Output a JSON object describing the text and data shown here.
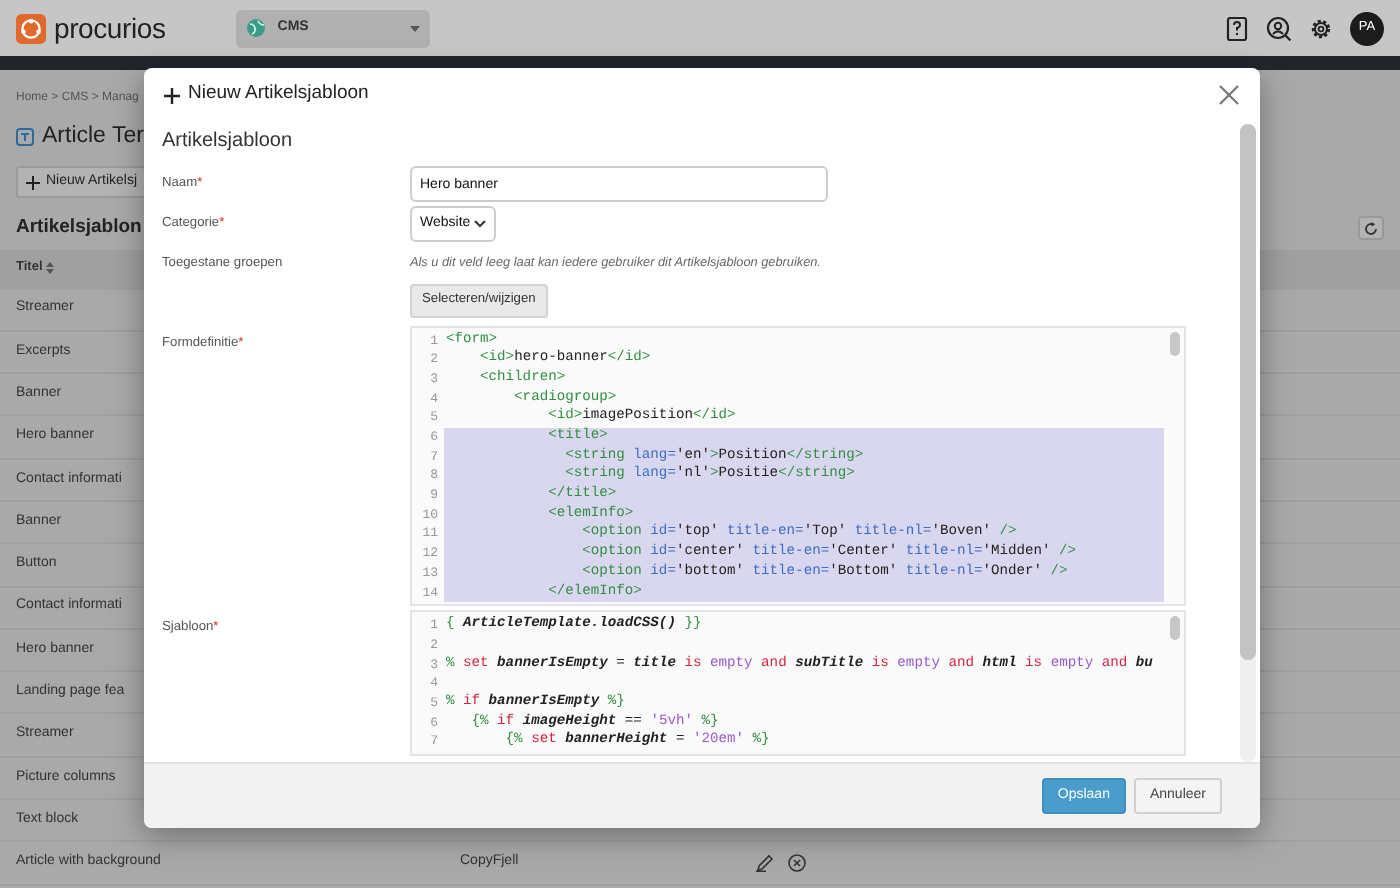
{
  "header": {
    "logo": "procurios",
    "app_switcher": "CMS",
    "avatar": "PA"
  },
  "breadcrumb": "Home > CMS > Manag",
  "page_title": "Article Ter",
  "new_button": "Nieuw Artikelsj",
  "section_title": "Artikelsjablon",
  "table": {
    "columns": [
      "Titel"
    ],
    "rows": [
      {
        "title": "Streamer"
      },
      {
        "title": "Excerpts"
      },
      {
        "title": "Banner"
      },
      {
        "title": "Hero banner"
      },
      {
        "title": "Contact informati"
      },
      {
        "title": "Banner"
      },
      {
        "title": "Button"
      },
      {
        "title": "Contact informati"
      },
      {
        "title": "Hero banner"
      },
      {
        "title": "Landing page fea"
      },
      {
        "title": "Streamer"
      },
      {
        "title": "Picture columns"
      },
      {
        "title": "Text block"
      },
      {
        "title": "Article with background",
        "column_2": "CopyFjell"
      }
    ]
  },
  "modal": {
    "title": "Nieuw Artikelsjabloon",
    "heading": "Artikelsjabloon",
    "fields": [
      {
        "kind": "text",
        "label": "Naam",
        "required_mark": "*",
        "value": "Hero banner"
      },
      {
        "kind": "select",
        "label": "Categorie",
        "required_mark": "*",
        "value": "Website"
      },
      {
        "kind": "groups",
        "label": "Toegestane groepen",
        "help": "Als u dit veld leeg laat kan iedere gebruiker dit Artikelsjabloon gebruiken.",
        "button": "Selecteren/wijzigen"
      },
      {
        "kind": "code",
        "label": "Formdefinitie",
        "required_mark": "*",
        "lines": [
          {
            "number": "1",
            "selected": false,
            "tokens": [
              {
                "kind": "tag",
                "text": "<form>"
              }
            ]
          },
          {
            "number": "2",
            "selected": false,
            "tokens": [
              {
                "kind": "tag",
                "text": "    <id>"
              },
              {
                "kind": "text",
                "text": "hero-banner"
              },
              {
                "kind": "tag",
                "text": "</id>"
              }
            ]
          },
          {
            "number": "3",
            "selected": false,
            "tokens": [
              {
                "kind": "tag",
                "text": "    <children>"
              }
            ]
          },
          {
            "number": "4",
            "selected": false,
            "tokens": [
              {
                "kind": "tag",
                "text": "        <radiogroup>"
              }
            ]
          },
          {
            "number": "5",
            "selected": false,
            "tokens": [
              {
                "kind": "tag",
                "text": "            <id>"
              },
              {
                "kind": "text",
                "text": "imagePosition"
              },
              {
                "kind": "tag",
                "text": "</id>"
              }
            ]
          },
          {
            "number": "6",
            "selected": true,
            "tokens": [
              {
                "kind": "tag",
                "text": "            <title>"
              }
            ]
          },
          {
            "number": "7",
            "selected": true,
            "tokens": [
              {
                "kind": "tag",
                "text": "              <string"
              },
              {
                "kind": "attr",
                "text": " lang="
              },
              {
                "kind": "text",
                "text": "'en'"
              },
              {
                "kind": "tag",
                "text": ">"
              },
              {
                "kind": "text",
                "text": "Position"
              },
              {
                "kind": "tag",
                "text": "</string>"
              }
            ]
          },
          {
            "number": "8",
            "selected": true,
            "tokens": [
              {
                "kind": "tag",
                "text": "              <string"
              },
              {
                "kind": "attr",
                "text": " lang="
              },
              {
                "kind": "text",
                "text": "'nl'"
              },
              {
                "kind": "tag",
                "text": ">"
              },
              {
                "kind": "text",
                "text": "Positie"
              },
              {
                "kind": "tag",
                "text": "</string>"
              }
            ]
          },
          {
            "number": "9",
            "selected": true,
            "tokens": [
              {
                "kind": "tag",
                "text": "            </title>"
              }
            ]
          },
          {
            "number": "10",
            "selected": true,
            "tokens": [
              {
                "kind": "tag",
                "text": "            <elemInfo>"
              }
            ]
          },
          {
            "number": "11",
            "selected": true,
            "tokens": [
              {
                "kind": "tag",
                "text": "                <option"
              },
              {
                "kind": "attr",
                "text": " id="
              },
              {
                "kind": "text",
                "text": "'top'"
              },
              {
                "kind": "attr",
                "text": " title-en="
              },
              {
                "kind": "text",
                "text": "'Top'"
              },
              {
                "kind": "attr",
                "text": " title-nl="
              },
              {
                "kind": "text",
                "text": "'Boven'"
              },
              {
                "kind": "tag",
                "text": " />"
              }
            ]
          },
          {
            "number": "12",
            "selected": true,
            "tokens": [
              {
                "kind": "tag",
                "text": "                <option"
              },
              {
                "kind": "attr",
                "text": " id="
              },
              {
                "kind": "text",
                "text": "'center'"
              },
              {
                "kind": "attr",
                "text": " title-en="
              },
              {
                "kind": "text",
                "text": "'Center'"
              },
              {
                "kind": "attr",
                "text": " title-nl="
              },
              {
                "kind": "text",
                "text": "'Midden'"
              },
              {
                "kind": "tag",
                "text": " />"
              }
            ]
          },
          {
            "number": "13",
            "selected": true,
            "tokens": [
              {
                "kind": "tag",
                "text": "                <option"
              },
              {
                "kind": "attr",
                "text": " id="
              },
              {
                "kind": "text",
                "text": "'bottom'"
              },
              {
                "kind": "attr",
                "text": " title-en="
              },
              {
                "kind": "text",
                "text": "'Bottom'"
              },
              {
                "kind": "attr",
                "text": " title-nl="
              },
              {
                "kind": "text",
                "text": "'Onder'"
              },
              {
                "kind": "tag",
                "text": " />"
              }
            ]
          },
          {
            "number": "14",
            "selected": true,
            "tokens": [
              {
                "kind": "tag",
                "text": "            </elemInfo>"
              }
            ]
          }
        ]
      },
      {
        "kind": "code",
        "label": "Sjabloon",
        "required_mark": "*",
        "lines": [
          {
            "number": "1",
            "selected": false,
            "tokens": [
              {
                "kind": "delim",
                "text": "{"
              },
              {
                "kind": "var",
                "text": " ArticleTemplate.loadCSS()"
              },
              {
                "kind": "delim",
                "text": " }}"
              }
            ]
          },
          {
            "number": "2",
            "selected": false
          },
          {
            "number": "3",
            "selected": false,
            "tokens": [
              {
                "kind": "delim",
                "text": "%"
              },
              {
                "kind": "kw",
                "text": " set"
              },
              {
                "kind": "var",
                "text": " bannerIsEmpty"
              },
              {
                "kind": "op",
                "text": " ="
              },
              {
                "kind": "var",
                "text": " title"
              },
              {
                "kind": "kw",
                "text": " is"
              },
              {
                "kind": "lit",
                "text": " empty"
              },
              {
                "kind": "kw",
                "text": " and"
              },
              {
                "kind": "var",
                "text": " subTitle"
              },
              {
                "kind": "kw",
                "text": " is"
              },
              {
                "kind": "lit",
                "text": " empty"
              },
              {
                "kind": "kw",
                "text": " and"
              },
              {
                "kind": "var",
                "text": " html"
              },
              {
                "kind": "kw",
                "text": " is"
              },
              {
                "kind": "lit",
                "text": " empty"
              },
              {
                "kind": "kw",
                "text": " and"
              },
              {
                "kind": "var",
                "text": " bu"
              }
            ]
          },
          {
            "number": "4",
            "selected": false
          },
          {
            "number": "5",
            "selected": false,
            "tokens": [
              {
                "kind": "delim",
                "text": "%"
              },
              {
                "kind": "kw",
                "text": " if"
              },
              {
                "kind": "var",
                "text": " bannerIsEmpty"
              },
              {
                "kind": "delim",
                "text": " %}"
              }
            ]
          },
          {
            "number": "6",
            "selected": false,
            "tokens": [
              {
                "kind": "delim",
                "text": "   {%"
              },
              {
                "kind": "kw",
                "text": " if"
              },
              {
                "kind": "var",
                "text": " imageHeight"
              },
              {
                "kind": "op",
                "text": " =="
              },
              {
                "kind": "lit",
                "text": " '5vh'"
              },
              {
                "kind": "delim",
                "text": " %}"
              }
            ]
          },
          {
            "number": "7",
            "selected": false,
            "tokens": [
              {
                "kind": "delim",
                "text": "       {%"
              },
              {
                "kind": "kw",
                "text": " set"
              },
              {
                "kind": "var",
                "text": " bannerHeight"
              },
              {
                "kind": "op",
                "text": " ="
              },
              {
                "kind": "lit",
                "text": " '20em'"
              },
              {
                "kind": "delim",
                "text": " %}"
              }
            ]
          }
        ]
      }
    ],
    "buttons": [
      {
        "label": "Opslaan",
        "kind": "primary"
      },
      {
        "label": "Annuleer",
        "kind": "secondary"
      }
    ]
  }
}
